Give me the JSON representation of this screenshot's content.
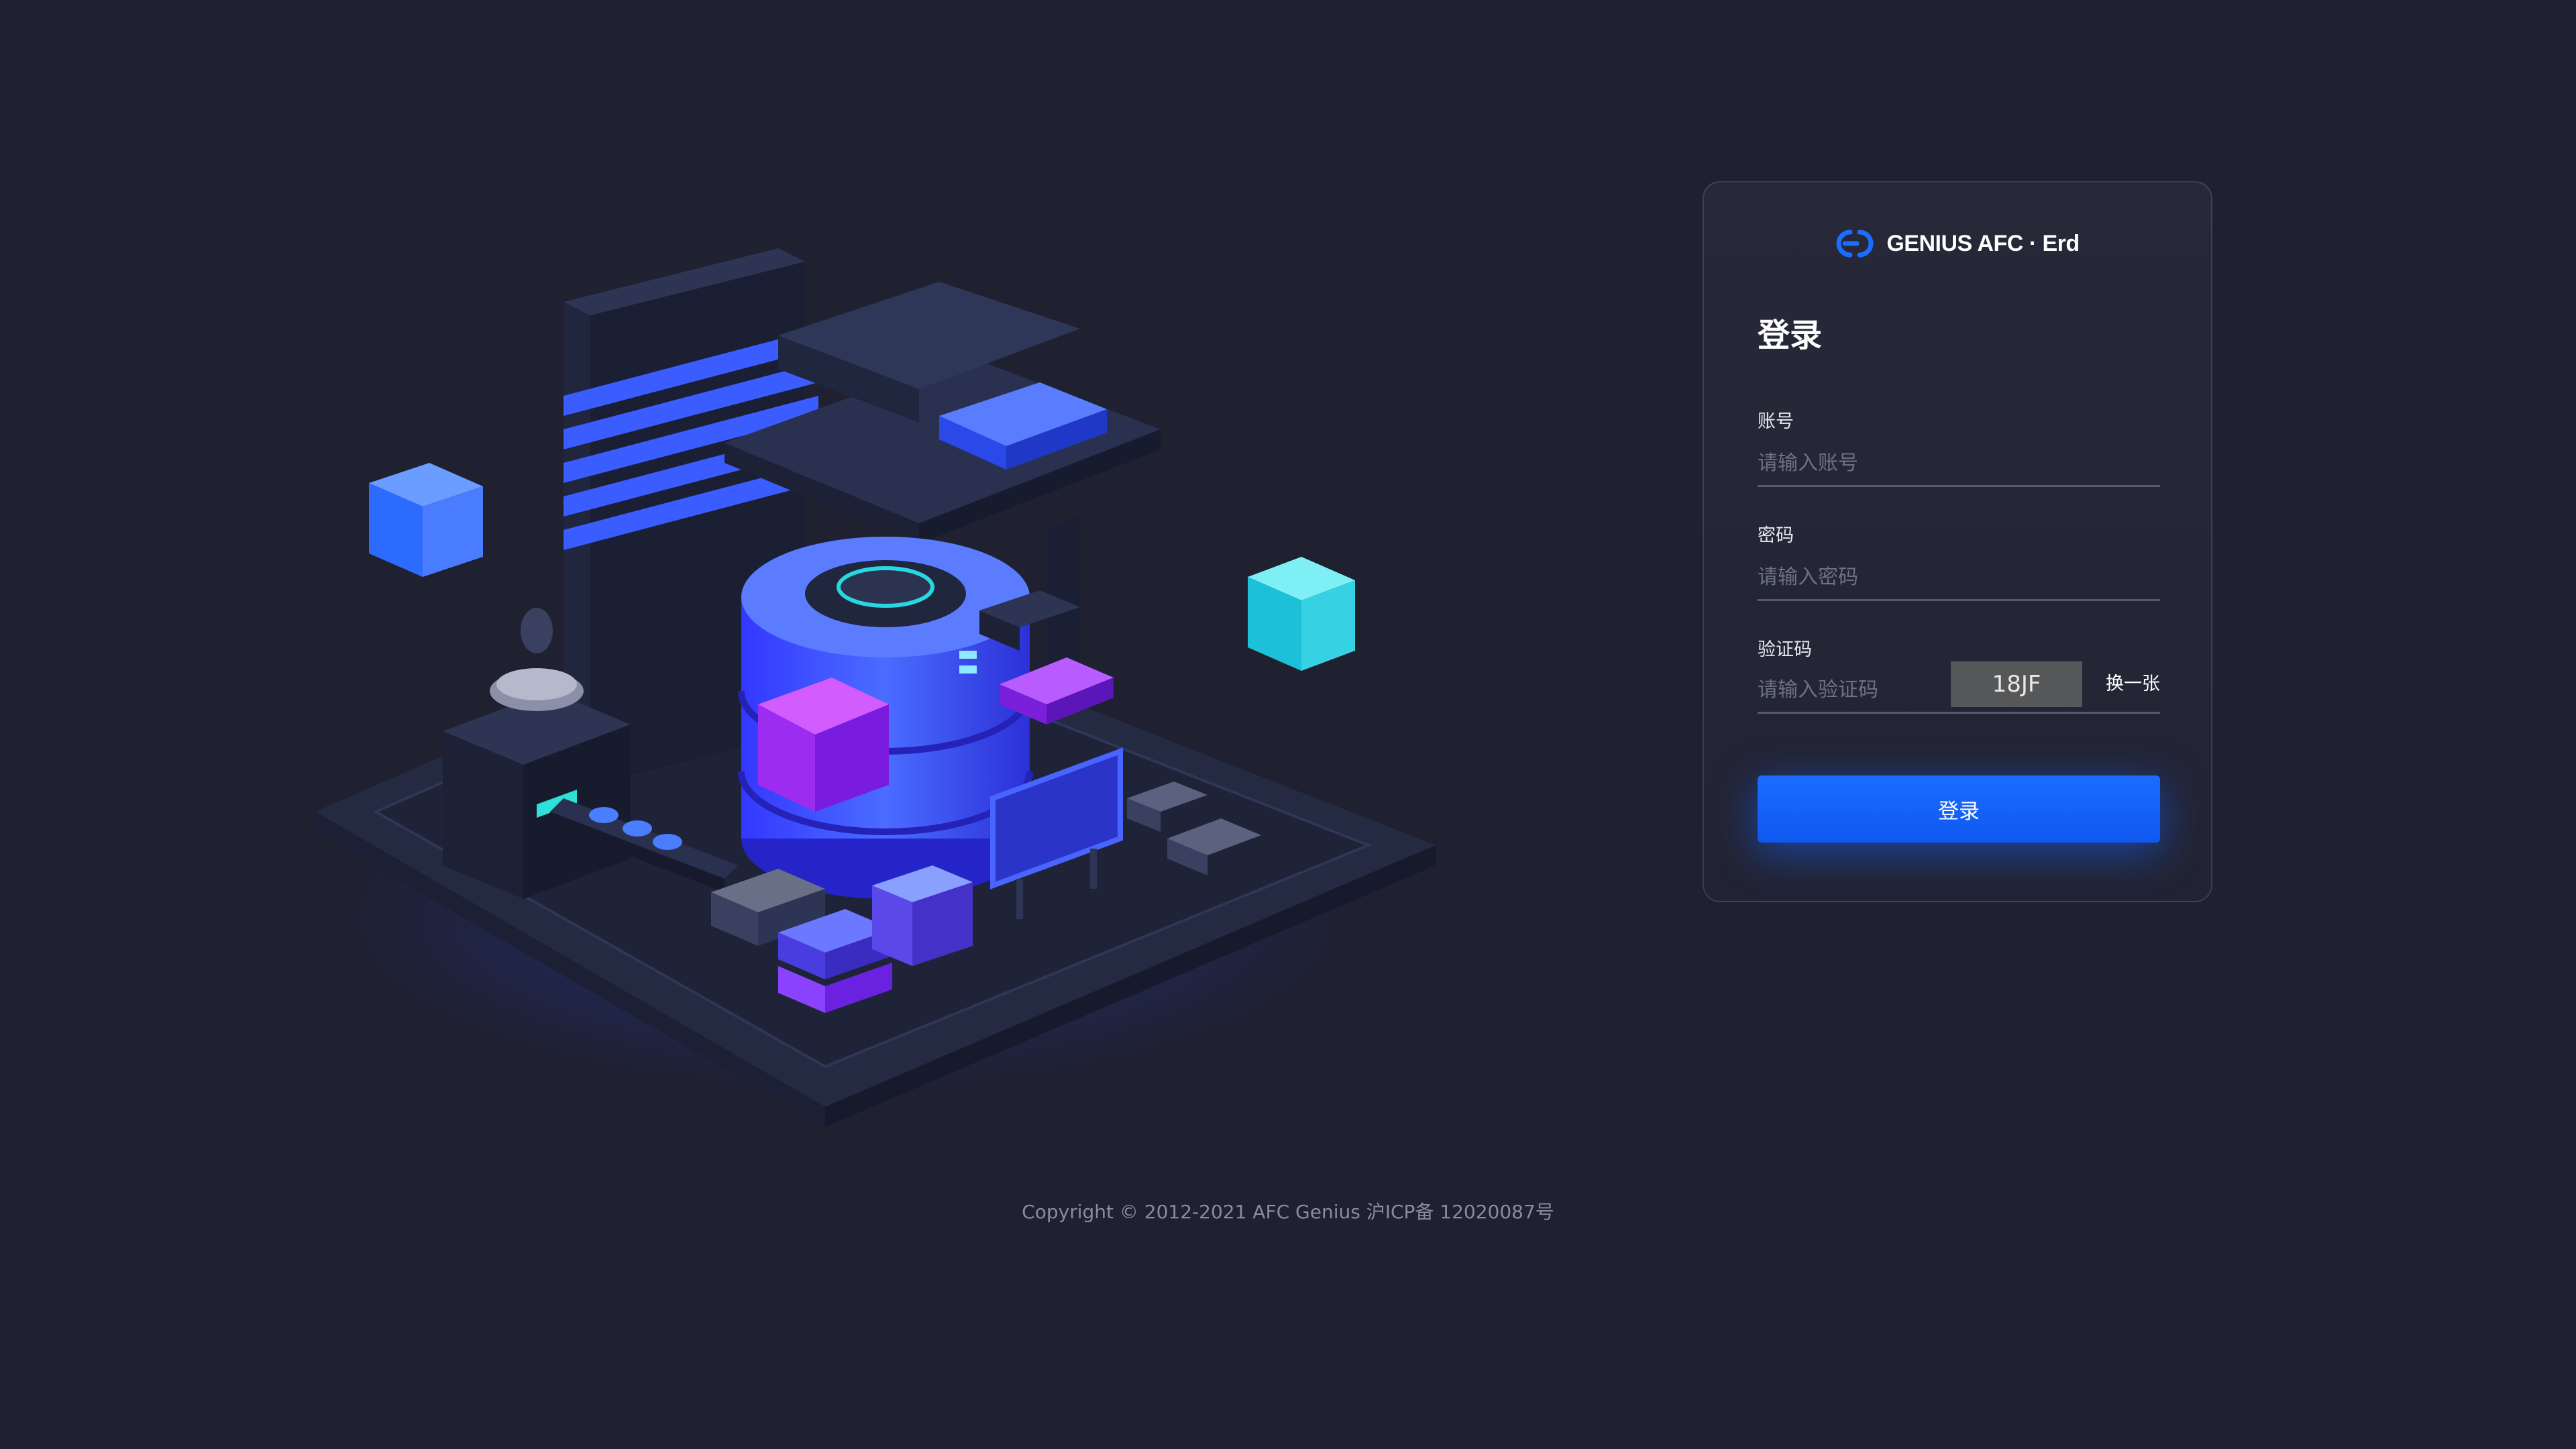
{
  "brand": {
    "name": "GENIUS AFC · Erd",
    "accent": "#1a6dff"
  },
  "login": {
    "title": "登录",
    "account": {
      "label": "账号",
      "placeholder": "请输入账号",
      "value": ""
    },
    "password": {
      "label": "密码",
      "placeholder": "请输入密码",
      "value": ""
    },
    "captcha": {
      "label": "验证码",
      "placeholder": "请输入验证码",
      "value": "",
      "code": "18JF",
      "refresh_label": "换一张"
    },
    "submit_label": "登录"
  },
  "footer": {
    "copyright": "Copyright © 2012-2021 AFC Genius 沪ICP备 12020087号"
  },
  "colors": {
    "background": "#1f2030",
    "card": "#252737",
    "button": "#1a6dff",
    "captcha_bg": "#565758"
  }
}
